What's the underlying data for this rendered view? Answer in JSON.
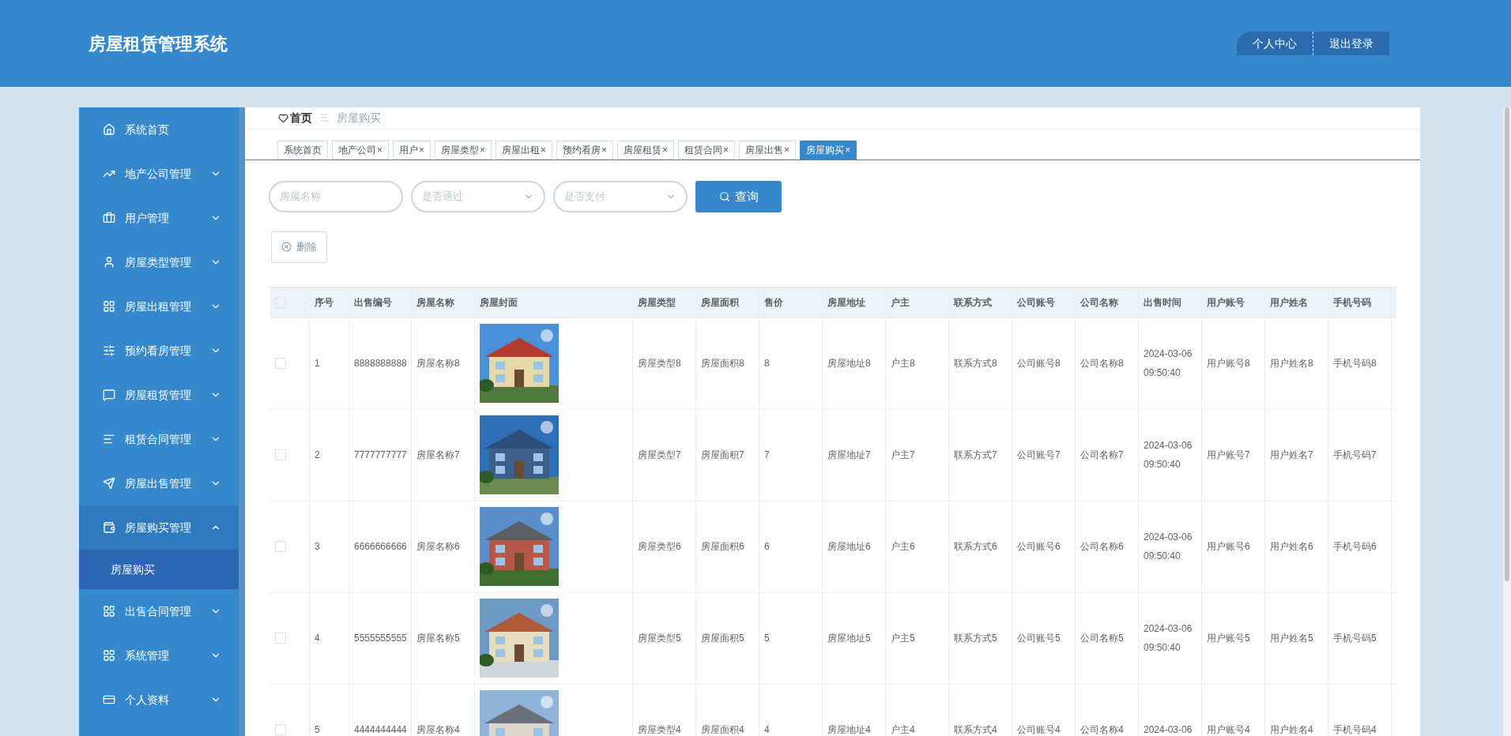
{
  "header": {
    "title": "房屋租赁管理系统",
    "buttons": [
      "个人中心",
      "退出登录"
    ]
  },
  "sidebar": {
    "items": [
      {
        "label": "系统首页",
        "kind": "link"
      },
      {
        "label": "地产公司管理",
        "kind": "menu",
        "expanded": false
      },
      {
        "label": "用户管理",
        "kind": "menu",
        "expanded": false
      },
      {
        "label": "房屋类型管理",
        "kind": "menu",
        "expanded": false
      },
      {
        "label": "房屋出租管理",
        "kind": "menu",
        "expanded": false
      },
      {
        "label": "预约看房管理",
        "kind": "menu",
        "expanded": false
      },
      {
        "label": "房屋租赁管理",
        "kind": "menu",
        "expanded": false
      },
      {
        "label": "租赁合同管理",
        "kind": "menu",
        "expanded": false
      },
      {
        "label": "房屋出售管理",
        "kind": "menu",
        "expanded": false
      },
      {
        "label": "房屋购买管理",
        "kind": "menu",
        "expanded": true,
        "children": [
          {
            "label": "房屋购买",
            "selected": true
          }
        ]
      },
      {
        "label": "出售合同管理",
        "kind": "menu",
        "expanded": false
      },
      {
        "label": "系统管理",
        "kind": "menu",
        "expanded": false
      },
      {
        "label": "个人资料",
        "kind": "menu",
        "expanded": false
      }
    ]
  },
  "breadcrumb": {
    "home": "首页",
    "separator": "三",
    "current": "房屋购买"
  },
  "tabs": [
    {
      "label": "系统首页",
      "closable": false,
      "selected": false
    },
    {
      "label": "地产公司",
      "closable": true,
      "selected": false
    },
    {
      "label": "用户",
      "closable": true,
      "selected": false
    },
    {
      "label": "房屋类型",
      "closable": true,
      "selected": false
    },
    {
      "label": "房屋出租",
      "closable": true,
      "selected": false
    },
    {
      "label": "预约看房",
      "closable": true,
      "selected": false
    },
    {
      "label": "房屋租赁",
      "closable": true,
      "selected": false
    },
    {
      "label": "租赁合同",
      "closable": true,
      "selected": false
    },
    {
      "label": "房屋出售",
      "closable": true,
      "selected": false
    },
    {
      "label": "房屋购买",
      "closable": true,
      "selected": true
    }
  ],
  "close_glyph": "×",
  "filters": {
    "name": {
      "placeholder": "房屋名称"
    },
    "approved": {
      "placeholder": "是否通过"
    },
    "paid": {
      "placeholder": "是否支付"
    },
    "search_button": "查询"
  },
  "delete_button": "删除",
  "table": {
    "all_checked": false,
    "columns": [
      "序号",
      "出售编号",
      "房屋名称",
      "房屋封面",
      "房屋类型",
      "房屋面积",
      "售价",
      "房屋地址",
      "户主",
      "联系方式",
      "公司账号",
      "公司名称",
      "出售时间",
      "用户账号",
      "用户姓名",
      "手机号码"
    ],
    "rows": [
      {
        "checked": false,
        "cells": [
          "1",
          "8888888888",
          "房屋名称8",
          null,
          "房屋类型8",
          "房屋面积8",
          "8",
          "房屋地址8",
          "户主8",
          "联系方式8",
          "公司账号8",
          "公司名称8",
          [
            "2024-03-06",
            "09:50:40"
          ],
          "用户账号8",
          "用户姓名8",
          "手机号码8"
        ],
        "cover": {
          "kind": "picture"
        }
      },
      {
        "checked": false,
        "cells": [
          "2",
          "7777777777",
          "房屋名称7",
          null,
          "房屋类型7",
          "房屋面积7",
          "7",
          "房屋地址7",
          "户主7",
          "联系方式7",
          "公司账号7",
          "公司名称7",
          [
            "2024-03-06",
            "09:50:40"
          ],
          "用户账号7",
          "用户姓名7",
          "手机号码7"
        ],
        "cover": {
          "kind": "picture"
        }
      },
      {
        "checked": false,
        "cells": [
          "3",
          "6666666666",
          "房屋名称6",
          null,
          "房屋类型6",
          "房屋面积6",
          "6",
          "房屋地址6",
          "户主6",
          "联系方式6",
          "公司账号6",
          "公司名称6",
          [
            "2024-03-06",
            "09:50:40"
          ],
          "用户账号6",
          "用户姓名6",
          "手机号码6"
        ],
        "cover": {
          "kind": "picture"
        }
      },
      {
        "checked": false,
        "cells": [
          "4",
          "5555555555",
          "房屋名称5",
          null,
          "房屋类型5",
          "房屋面积5",
          "5",
          "房屋地址5",
          "户主5",
          "联系方式5",
          "公司账号5",
          "公司名称5",
          [
            "2024-03-06",
            "09:50:40"
          ],
          "用户账号5",
          "用户姓名5",
          "手机号码5"
        ],
        "cover": {
          "kind": "picture"
        }
      },
      {
        "checked": false,
        "cells": [
          "5",
          "4444444444",
          "房屋名称4",
          null,
          "房屋类型4",
          "房屋面积4",
          "4",
          "房屋地址4",
          "户主4",
          "联系方式4",
          "公司账号4",
          "公司名称4",
          [
            "2024-03-06"
          ],
          "用户账号4",
          "用户姓名4",
          "手机号码4"
        ],
        "cover": {
          "kind": "picture"
        }
      }
    ]
  }
}
